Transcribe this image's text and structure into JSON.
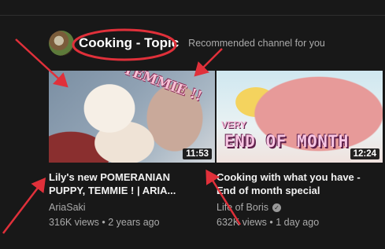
{
  "shelf": {
    "title": "Cooking - Topic",
    "subtitle": "Recommended channel for you"
  },
  "videos": [
    {
      "thumb_text": "TEMMIE !!",
      "duration": "11:53",
      "title_line1": "Lily's new POMERANIAN",
      "title_line2": "PUPPY, TEMMIE ! | ARIA...",
      "channel": "AriaSaki",
      "stats": "316K views • 2 years ago"
    },
    {
      "thumb_text_small": "VERY",
      "thumb_text_big": "END OF MONTH",
      "duration": "12:24",
      "title_line1": "Cooking with what you have -",
      "title_line2": "End of month special",
      "channel": "Life of Boris",
      "verified_icon": "check-icon",
      "stats": "632K views • 1 day ago"
    }
  ],
  "annotation_color": "#e0303a"
}
